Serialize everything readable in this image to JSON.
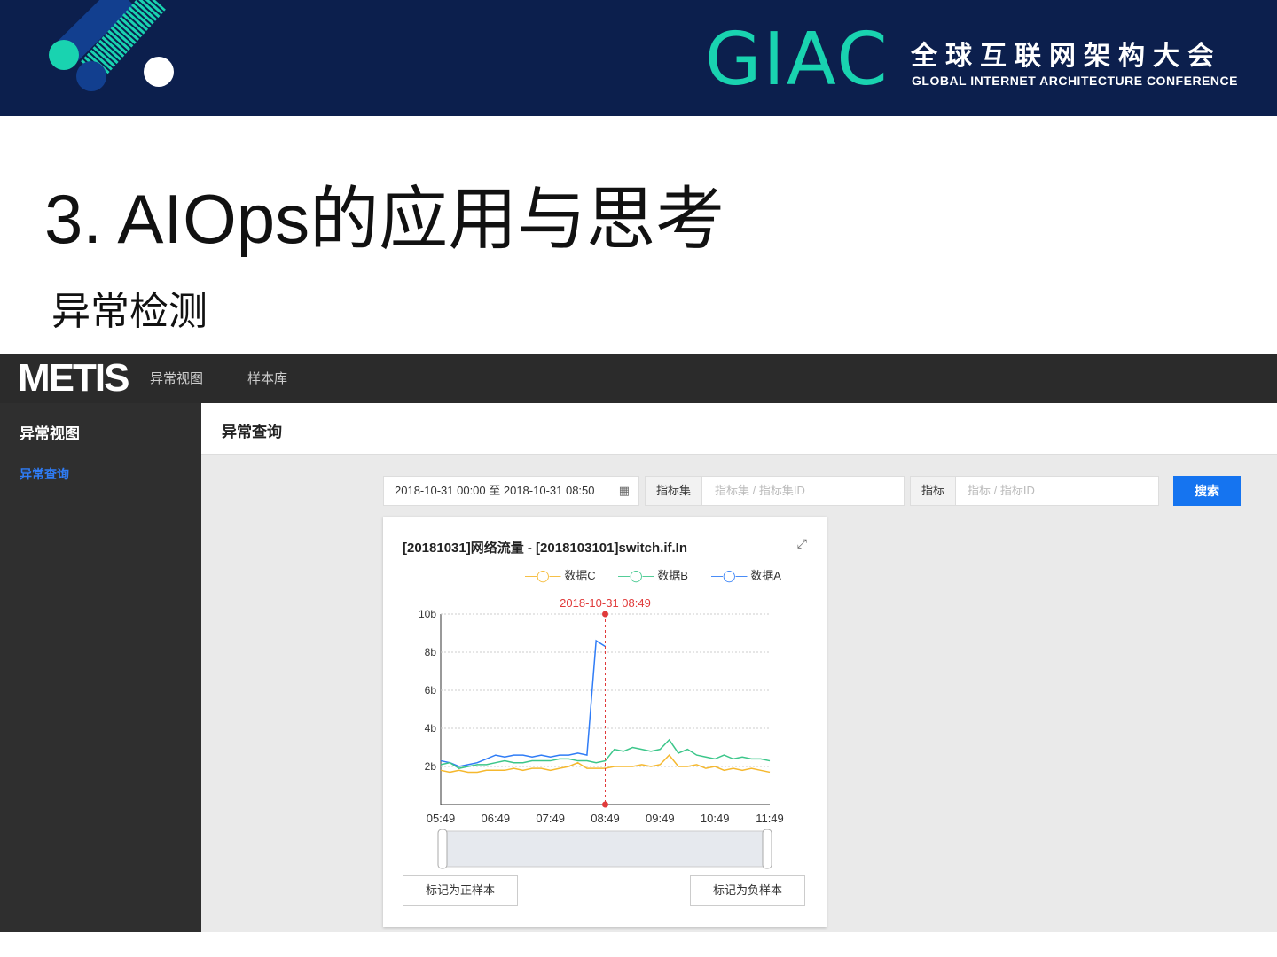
{
  "banner": {
    "logo_text": "GIAC",
    "title_cn": "全球互联网架构大会",
    "title_en": "GLOBAL INTERNET ARCHITECTURE CONFERENCE"
  },
  "slide": {
    "title": "3. AIOps的应用与思考",
    "subtitle": "异常检测"
  },
  "app": {
    "logo": "METIS",
    "nav": [
      "异常视图",
      "样本库"
    ],
    "sidebar": {
      "heading": "异常视图",
      "items": [
        "异常查询"
      ]
    },
    "page_title": "异常查询",
    "filters": {
      "date_range": "2018-10-31 00:00 至 2018-10-31 08:50",
      "metric_set_label": "指标集",
      "metric_set_placeholder": "指标集 / 指标集ID",
      "metric_label": "指标",
      "metric_placeholder": "指标 / 指标ID",
      "search": "搜索"
    },
    "buttons": {
      "positive": "标记为正样本",
      "negative": "标记为负样本"
    }
  },
  "chart_data": {
    "type": "line",
    "title": "[20181031]网络流量 - [2018103101]switch.if.In",
    "marker_label": "2018-10-31 08:49",
    "marker_x": 180,
    "x_labels": [
      "05:49",
      "06:49",
      "07:49",
      "08:49",
      "09:49",
      "10:49",
      "11:49"
    ],
    "x_range_minutes": [
      0,
      360
    ],
    "y_labels": [
      "2b",
      "4b",
      "6b",
      "8b",
      "10b"
    ],
    "ylim": [
      0,
      10
    ],
    "series": [
      {
        "name": "数据C",
        "color": "#f5b82e",
        "x_step": 10,
        "values": [
          1.8,
          1.7,
          1.8,
          1.7,
          1.7,
          1.8,
          1.8,
          1.8,
          1.9,
          1.8,
          1.9,
          1.9,
          1.8,
          1.9,
          2.0,
          2.2,
          1.9,
          1.9,
          1.9,
          2.0,
          2.0,
          2.0,
          2.1,
          2.0,
          2.1,
          2.6,
          2.0,
          2.0,
          2.1,
          1.9,
          2.0,
          1.8,
          1.9,
          1.8,
          1.9,
          1.8,
          1.7
        ]
      },
      {
        "name": "数据B",
        "color": "#3cc68a",
        "x_step": 10,
        "values": [
          2.1,
          2.2,
          1.9,
          2.0,
          2.1,
          2.1,
          2.2,
          2.3,
          2.2,
          2.2,
          2.3,
          2.3,
          2.3,
          2.4,
          2.4,
          2.3,
          2.3,
          2.2,
          2.3,
          2.9,
          2.8,
          3.0,
          2.9,
          2.8,
          2.9,
          3.4,
          2.7,
          2.9,
          2.6,
          2.5,
          2.4,
          2.6,
          2.4,
          2.5,
          2.4,
          2.4,
          2.3
        ]
      },
      {
        "name": "数据A",
        "color": "#2f7cf6",
        "x_step": 10,
        "values": [
          2.3,
          2.2,
          2.0,
          2.1,
          2.2,
          2.4,
          2.6,
          2.5,
          2.6,
          2.6,
          2.5,
          2.6,
          2.5,
          2.6,
          2.6,
          2.7,
          2.6,
          8.6,
          8.3
        ]
      }
    ]
  }
}
